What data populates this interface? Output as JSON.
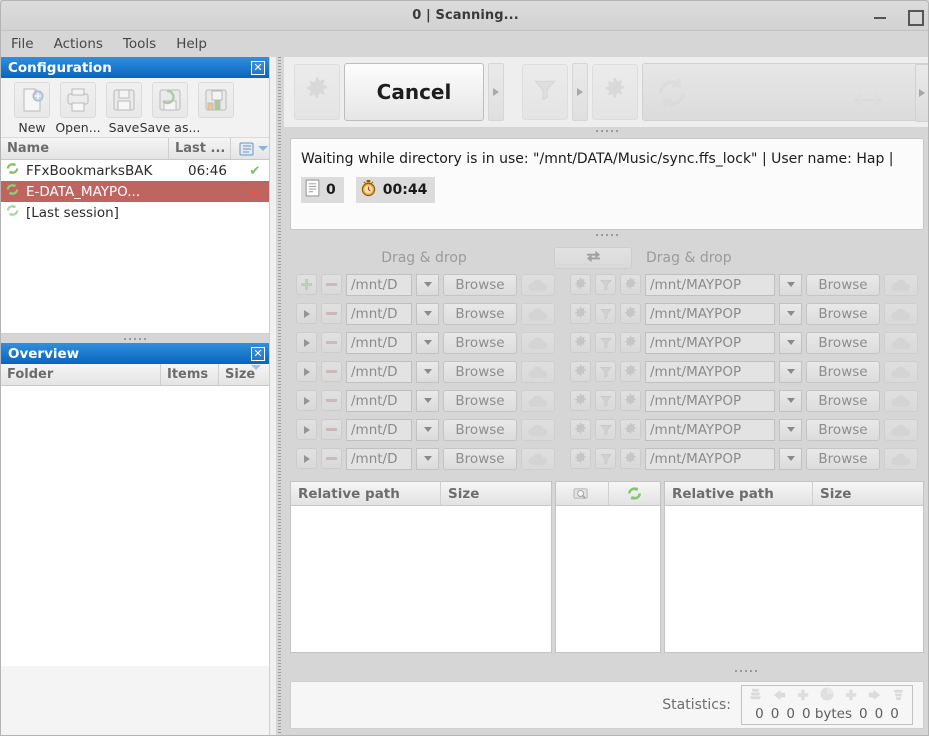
{
  "window": {
    "title": "0 | Scanning...",
    "minimize_label": "–",
    "maximize_label": "□"
  },
  "menubar": {
    "items": [
      {
        "label": "File"
      },
      {
        "label": "Actions"
      },
      {
        "label": "Tools"
      },
      {
        "label": "Help"
      }
    ]
  },
  "configuration_pane": {
    "caption": "Configuration",
    "close_label": "✕",
    "toolbar": [
      {
        "label": "New",
        "icon": "new-config-icon"
      },
      {
        "label": "Open...",
        "icon": "open-config-icon"
      },
      {
        "label": "Save",
        "icon": "save-config-icon"
      },
      {
        "label": "Save as...",
        "icon": "save-as-config-icon"
      },
      {
        "label": "",
        "icon": "save-batch-icon"
      }
    ],
    "columns": {
      "name": "Name",
      "last": "Last ...",
      "icon": "column-settings-icon"
    },
    "rows": [
      {
        "name": "FFxBookmarksBAK",
        "last_sync": "06:46",
        "status": "✔",
        "status_color": "#7bbf6a",
        "selected": false
      },
      {
        "name": "E-DATA_MAYPO...",
        "last_sync": "",
        "status": "–",
        "status_color": "#ff4a3d",
        "selected": true
      },
      {
        "name": "[Last session]",
        "last_sync": "",
        "status": "",
        "status_color": "#7bbf6a",
        "selected": false
      }
    ]
  },
  "overview_pane": {
    "caption": "Overview",
    "close_label": "✕",
    "columns": {
      "folder": "Folder",
      "items": "Items",
      "size": "Size"
    },
    "rows": []
  },
  "main_toolbar": {
    "compare_icon": "compare-gear-icon",
    "cancel_label": "Cancel",
    "filter_icon": "filter-funnel-icon",
    "sync_settings_icon": "sync-gear-icon",
    "sync_icon": "sync-refresh-icon",
    "swap_icon": "swap-arrows-icon",
    "overflow_arrow": "▶"
  },
  "status": {
    "message": "Waiting while directory is in use: \"/mnt/DATA/Music/sync.ffs_lock\" | User name: Hap |",
    "items_icon": "document-icon",
    "items_count": "0",
    "timer_icon": "stopwatch-icon",
    "elapsed_time": "00:44"
  },
  "folder_pairs": {
    "drag_drop_left": "Drag & drop",
    "drag_drop_right": "Drag & drop",
    "swap_icon": "swap-sides-icon",
    "add_icon": "add-pair-icon",
    "remove_icon": "remove-pair-icon",
    "expand_icon": "expand-pair-icon",
    "browse_label": "Browse",
    "cloud_icon": "cloud-icon",
    "local_settings_icon": "local-settings-gear-icon",
    "local_filter_icon": "local-filter-funnel-icon",
    "local_sync_icon": "local-sync-gear-icon",
    "dropdown_icon": "chevron-down-icon",
    "rows": [
      {
        "left_path": "/mnt/D",
        "right_path": "/mnt/MAYPOP",
        "first": true
      },
      {
        "left_path": "/mnt/D",
        "right_path": "/mnt/MAYPOP",
        "first": false
      },
      {
        "left_path": "/mnt/D",
        "right_path": "/mnt/MAYPOP",
        "first": false
      },
      {
        "left_path": "/mnt/D",
        "right_path": "/mnt/MAYPOP",
        "first": false
      },
      {
        "left_path": "/mnt/D",
        "right_path": "/mnt/MAYPOP",
        "first": false
      },
      {
        "left_path": "/mnt/D",
        "right_path": "/mnt/MAYPOP",
        "first": false
      },
      {
        "left_path": "/mnt/D",
        "right_path": "/mnt/MAYPOP",
        "first": false
      }
    ]
  },
  "file_grids": {
    "left": {
      "col_path": "Relative path",
      "col_size": "Size",
      "rows": []
    },
    "middle": {
      "preview_icon": "preview-magnifier-icon",
      "sync_direction_icon": "sync-direction-icon",
      "rows": []
    },
    "right": {
      "col_path": "Relative path",
      "col_size": "Size",
      "rows": []
    }
  },
  "statistics": {
    "label": "Statistics:",
    "icons": [
      "create-left-icon",
      "update-left-icon",
      "delete-left-icon",
      "data-pie-icon",
      "create-right-icon",
      "update-right-icon",
      "delete-right-icon"
    ],
    "values": [
      "0",
      "0",
      "0",
      "0 bytes",
      "0",
      "0",
      "0"
    ]
  },
  "colors": {
    "caption_blue_top": "#2f8fe0",
    "caption_blue_bottom": "#0a64bd",
    "selected_row_red": "#c0645f",
    "window_bg": "#d6d6d6",
    "panel_bg": "#f4f4f4"
  }
}
